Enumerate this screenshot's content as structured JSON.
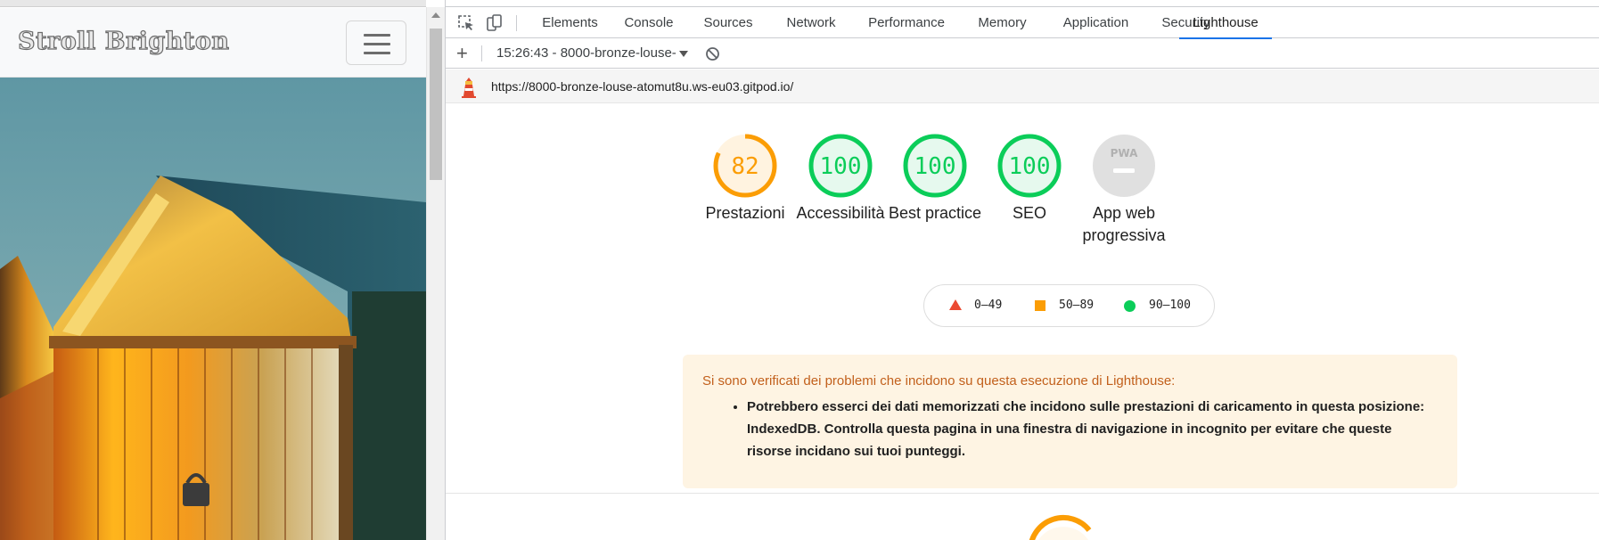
{
  "site": {
    "brand": "Stroll Brighton",
    "hero_alt": "Colourful Brighton beach huts at sunset"
  },
  "devtools": {
    "tabs": [
      {
        "label": "Elements"
      },
      {
        "label": "Console"
      },
      {
        "label": "Sources"
      },
      {
        "label": "Network"
      },
      {
        "label": "Performance"
      },
      {
        "label": "Memory"
      },
      {
        "label": "Application"
      },
      {
        "label": "Security"
      },
      {
        "label": "Lighthouse"
      }
    ],
    "active_tab": "Lighthouse",
    "toolbar": {
      "report_selector": "15:26:43 - 8000-bronze-louse-"
    },
    "url": "https://8000-bronze-louse-atomut8u.ws-eu03.gitpod.io/"
  },
  "report": {
    "gauges": [
      {
        "label": "Prestazioni",
        "score": "82",
        "value": 82,
        "color": "#fb9d05",
        "fill": "#fff3e0"
      },
      {
        "label": "Accessibilità",
        "score": "100",
        "value": 100,
        "color": "#0bcd59",
        "fill": "#e6f9ee"
      },
      {
        "label": "Best practice",
        "score": "100",
        "value": 100,
        "color": "#0bcd59",
        "fill": "#e6f9ee"
      },
      {
        "label": "SEO",
        "score": "100",
        "value": 100,
        "color": "#0bcd59",
        "fill": "#e6f9ee"
      },
      {
        "label": "App web progressiva",
        "score": "PWA",
        "color": "#cccccc",
        "fill": "#e0e0e0"
      }
    ],
    "legend": [
      {
        "range": "0–49",
        "color": "#eb4a32",
        "shape": "triangle"
      },
      {
        "range": "50–89",
        "color": "#fb9d05",
        "shape": "square"
      },
      {
        "range": "90–100",
        "color": "#0bcd59",
        "shape": "circle"
      }
    ],
    "warning": {
      "title": "Si sono verificati dei problemi che incidono su questa esecuzione di Lighthouse:",
      "items": [
        "Potrebbero esserci dei dati memorizzati che incidono sulle prestazioni di caricamento in questa posizione: IndexedDB. Controlla questa pagina in una finestra di navigazione in incognito per evitare che queste risorse incidano sui tuoi punteggi."
      ]
    }
  }
}
